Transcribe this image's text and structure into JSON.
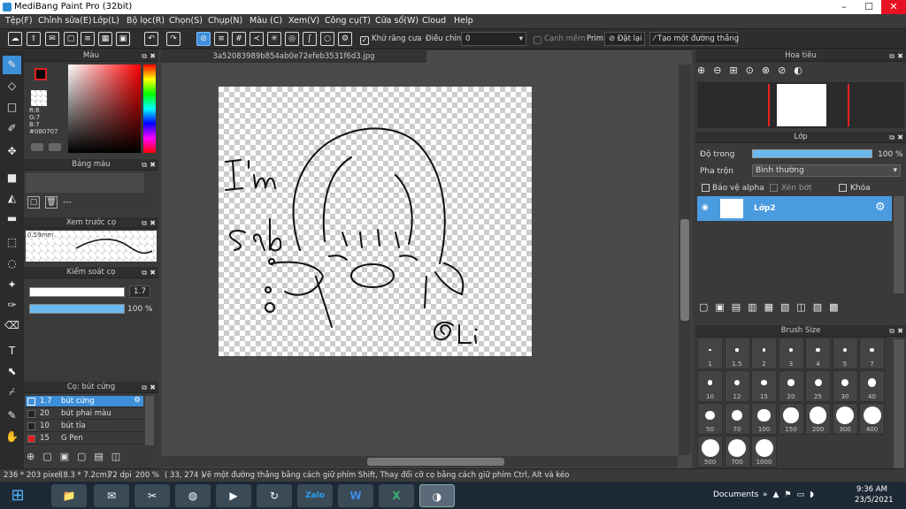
{
  "window": {
    "title": "MediBang Paint Pro (32bit)"
  },
  "menu": [
    "Tệp(F)",
    "Chỉnh sửa(E)",
    "Lớp(L)",
    "Bộ lọc(R)",
    "Chọn(S)",
    "Chụp(N)",
    "Màu (C)",
    "Xem(V)",
    "Công cụ(T)",
    "Cửa sổ(W)",
    "Cloud",
    "Help"
  ],
  "toolbar": {
    "antialias_label": "Khử răng cưa",
    "adjust_label": "Điều chỉnh",
    "adjust_value": "0",
    "snap_label": "Cạnh mềm",
    "prim_label": "Prim",
    "reset_label": "Đặt lại",
    "straight_label": "Tạo một đường thẳng"
  },
  "color_panel": {
    "title": "Màu",
    "r": "R:8",
    "g": "G:7",
    "b": "B:7",
    "hex": "#080707",
    "fg_color": "#080707",
    "bg_color": "#ffffff"
  },
  "palette_panel": {
    "title": "Bảng màu",
    "value": "---"
  },
  "preview_panel": {
    "title": "Xem trước cọ",
    "size": "0.59mm"
  },
  "control_panel": {
    "title": "Kiểm soát cọ",
    "size_value": "1.7",
    "opacity_value": "100 %"
  },
  "brush_panel": {
    "title": "Cọ: bút cứng",
    "brushes": [
      {
        "size": "1.7",
        "name": "bút cứng",
        "color": "#3e8fd9"
      },
      {
        "size": "20",
        "name": "bút phai màu",
        "color": "#222222"
      },
      {
        "size": "10",
        "name": "bút tỉa",
        "color": "#222222"
      },
      {
        "size": "15",
        "name": "G Pen",
        "color": "#e02020"
      }
    ]
  },
  "document": {
    "tab": "3a52083989b854ab0e72efeb3531f6d3.jpg",
    "drawing_text": [
      "I'm",
      "sab",
      "@Li"
    ]
  },
  "navigator": {
    "title": "Hoa tiêu"
  },
  "layer_panel": {
    "title": "Lớp",
    "opacity_label": "Độ trong",
    "opacity_value": "100 %",
    "blend_label": "Pha trộn",
    "blend_value": "Bình thường",
    "protect_alpha": "Bảo vệ alpha",
    "clip": "Xén bớt",
    "lock": "Khóa",
    "layers": [
      {
        "name": "Lớp2"
      }
    ]
  },
  "brush_size": {
    "title": "Brush Size",
    "sizes": [
      "1",
      "1.5",
      "2",
      "3",
      "4",
      "5",
      "7",
      "10",
      "12",
      "15",
      "20",
      "25",
      "30",
      "40",
      "50",
      "70",
      "100",
      "150",
      "200",
      "300",
      "400",
      "500",
      "700",
      "1000"
    ]
  },
  "status": {
    "size": "236 * 203 pixel",
    "cm": "(8.3 * 7.2cm)",
    "dpi": "72 dpi",
    "zoom": "200 %",
    "coords": "( 33, 274 )",
    "hint": "Vẽ một đường thẳng bằng cách giữ phím Shift, Thay đổi cỡ cọ bằng cách giữ phím Ctrl, Alt và kéo"
  },
  "taskbar": {
    "zalo_label": "Zalo",
    "documents": "Documents",
    "time": "9:36 AM",
    "date": "23/5/2021"
  }
}
